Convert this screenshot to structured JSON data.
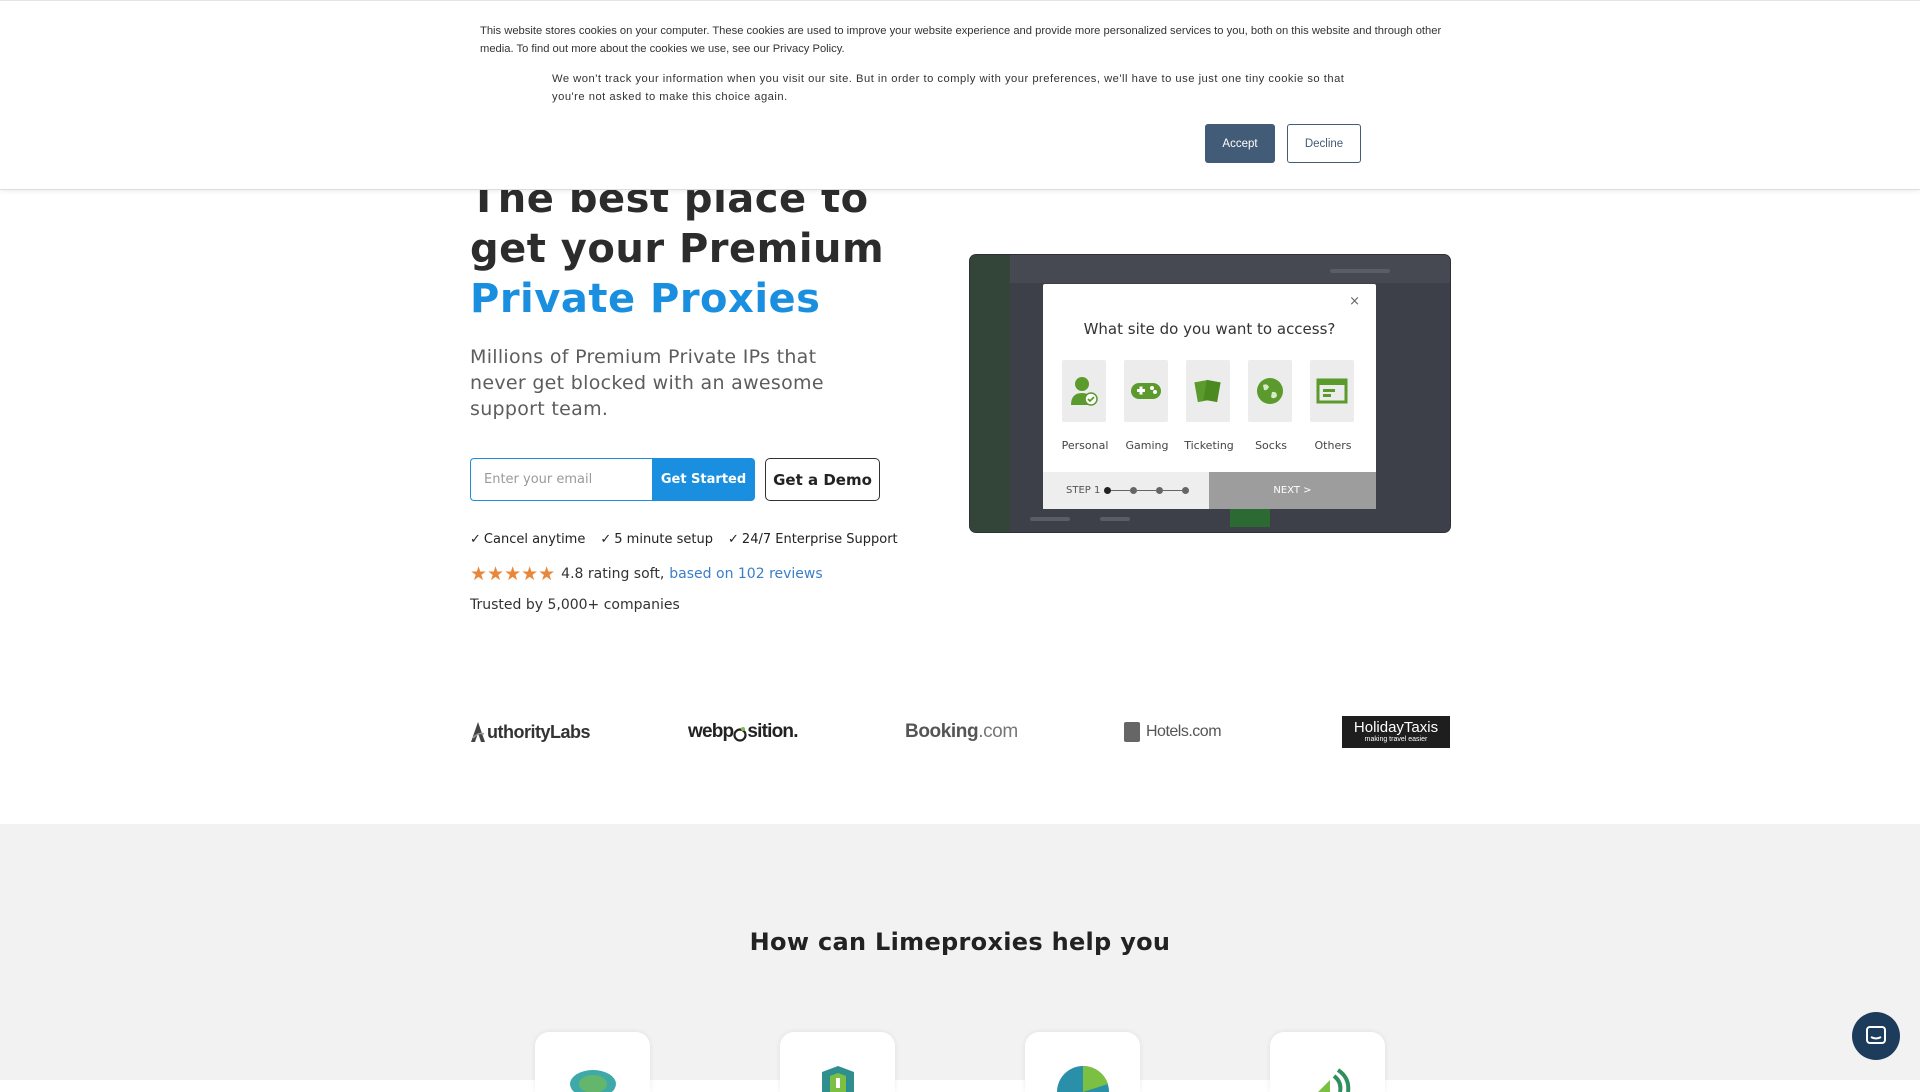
{
  "cookie_banner": {
    "text": "This website stores cookies on your computer. These cookies are used to improve your website experience and provide more personalized services to you, both on this website and through other media. To find out more about the cookies we use, see our Privacy Policy.",
    "secondary_text": "We won't track your information when you visit our site. But in order to comply with your preferences, we'll have to use just one tiny cookie so that you're not asked to make this choice again.",
    "accept_label": "Accept",
    "decline_label": "Decline",
    "accept_color": "#425b76"
  },
  "hero": {
    "headline_line1": "The best place to",
    "headline_line2": "get your Premium",
    "headline_accent": "Private Proxies",
    "subtitle": "Millions of Premium Private IPs that never get blocked with an awesome support team.",
    "email_placeholder": "Enter your email",
    "get_started_label": "Get Started",
    "demo_label": "Get a Demo",
    "accent_color": "#1a8fe0",
    "features": [
      "Cancel anytime",
      "5 minute setup",
      "24/7 Enterprise Support"
    ],
    "check_glyph": "✓",
    "stars": "★★★★★",
    "rating_text": "4.8 rating soft,",
    "reviews_link": "based on 102 reviews",
    "trusted": "Trusted by 5,000+ companies"
  },
  "mockup": {
    "modal_title": "What site do you want to access?",
    "close_glyph": "×",
    "options": [
      "Personal",
      "Gaming",
      "Ticketing",
      "Socks",
      "Others"
    ],
    "step_label": "STEP 1",
    "next_label": "NEXT >"
  },
  "logos": {
    "authority": "uthorityLabs",
    "webposition_a": "webp",
    "webposition_b": "sition.",
    "booking_a": "Booking",
    "booking_b": ".com",
    "hotels": "Hotels.com",
    "holiday_1": "HolidayTaxis",
    "holiday_2": "making travel easier"
  },
  "help": {
    "title": "How can Limeproxies help you"
  }
}
